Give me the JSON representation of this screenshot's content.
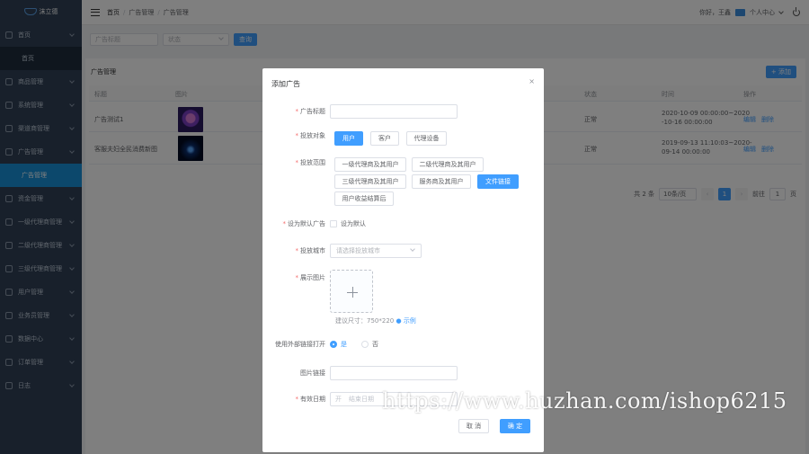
{
  "app": {
    "name": "沫立德"
  },
  "breadcrumb": {
    "home": "首页",
    "section": "广告管理",
    "current": "广告管理"
  },
  "topbar": {
    "greeting": "你好，王鑫",
    "user_menu": "个人中心"
  },
  "sidebar": {
    "items": [
      {
        "label": "首页"
      },
      {
        "label": "首页",
        "sub": true
      },
      {
        "label": "商品管理"
      },
      {
        "label": "系统管理"
      },
      {
        "label": "渠道商管理"
      },
      {
        "label": "广告管理"
      },
      {
        "label": "广告管理",
        "sub": true,
        "active": true
      },
      {
        "label": "资金管理"
      },
      {
        "label": "一级代理商管理"
      },
      {
        "label": "二级代理商管理"
      },
      {
        "label": "三级代理商管理"
      },
      {
        "label": "用户管理"
      },
      {
        "label": "业务员管理"
      },
      {
        "label": "数据中心"
      },
      {
        "label": "订单管理"
      },
      {
        "label": "日志"
      }
    ]
  },
  "search": {
    "title_placeholder": "广告标题",
    "status_placeholder": "状态",
    "search_label": "查询"
  },
  "panel": {
    "title": "广告管理",
    "add_label": "+ 添加"
  },
  "table": {
    "columns": [
      "标题",
      "图片",
      "",
      "状态",
      "时间",
      "操作"
    ],
    "rows": [
      {
        "title": "广告测试1",
        "status": "正常",
        "time_line1": "2020-10-09 00:00:00~2020",
        "time_line2": "-10-16 00:00:00",
        "edit": "编辑",
        "delete": "删除"
      },
      {
        "title": "客服夫妇全民消费新图",
        "status": "正常",
        "time_line1": "2019-09-13 11:10:03~2020-",
        "time_line2": "09-14 00:00:00",
        "edit": "编辑",
        "delete": "删除"
      }
    ]
  },
  "pager": {
    "total": "共 2 条",
    "page_size": "10条/页",
    "current": "1",
    "goto": "前往",
    "goto_page": "1",
    "page_unit": "页"
  },
  "dialog": {
    "title": "添加广告",
    "labels": {
      "ad_title": "广告标题",
      "target": "投放对象",
      "scope": "投放范围",
      "default_ad": "设为默认广告",
      "city": "投放城市",
      "image": "展示图片",
      "external": "使用外部链接打开",
      "image_link": "图片链接",
      "valid_date": "有效日期"
    },
    "target_options": [
      "用户",
      "客户",
      "代理设备"
    ],
    "scope_options": [
      "一级代理商及其用户",
      "二级代理商及其用户",
      "三级代理商及其用户",
      "服务商及其用户",
      "文件链接",
      "用户收益结算后"
    ],
    "default_checkbox_label": "设为默认",
    "city_placeholder": "请选择投放城市",
    "image_hint": "建议尺寸：750*220",
    "image_hint_link": "示例",
    "radio_yes": "是",
    "radio_no": "否",
    "date_start": "开",
    "date_end": "结束日期",
    "cancel": "取 消",
    "confirm": "确 定"
  },
  "watermark": "https://www.huzhan.com/ishop6215",
  "colors": {
    "primary": "#409eff",
    "sidebar": "#304156",
    "sidebar_active": "#1890d8"
  }
}
